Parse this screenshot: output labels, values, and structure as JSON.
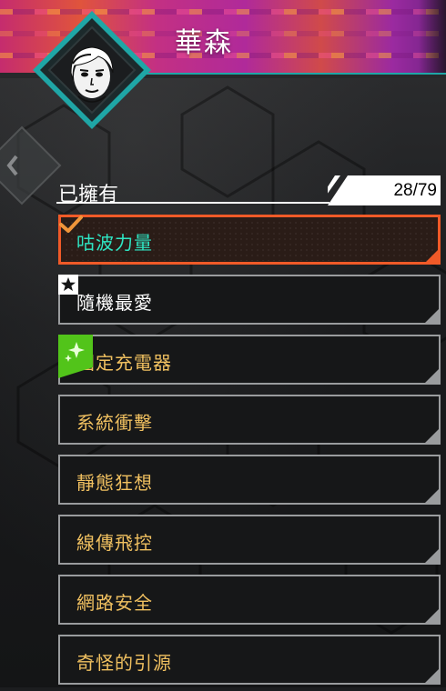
{
  "header": {
    "title": "華森"
  },
  "owned": {
    "label": "已擁有",
    "count": "28/79"
  },
  "items": [
    {
      "label": "咕波力量",
      "selected": true,
      "equipped_icon": "check-icon"
    },
    {
      "label": "隨機最愛",
      "favorite_icon": "star-icon"
    },
    {
      "label": "固定充電器",
      "new_icon": "sparkle-icon"
    },
    {
      "label": "系統衝擊"
    },
    {
      "label": "靜態狂想"
    },
    {
      "label": "線傳飛控"
    },
    {
      "label": "網路安全"
    },
    {
      "label": "奇怪的引源"
    }
  ],
  "colors": {
    "accent_orange": "#f05a28",
    "label_gold": "#f0c060",
    "selected_teal": "#2ee6c4",
    "badge_green": "#52c41a",
    "frame_teal": "#1fa6a6"
  }
}
